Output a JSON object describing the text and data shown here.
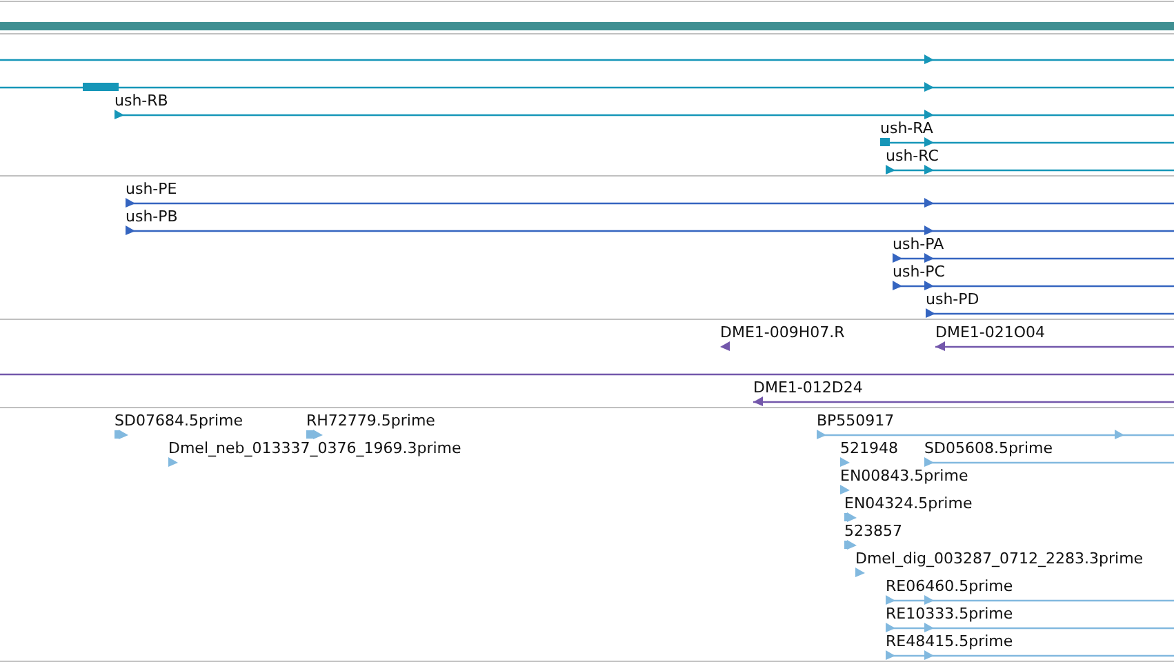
{
  "tracks": [
    {
      "kind": "sequence",
      "color": "#3f8f92"
    },
    {
      "kind": "transcript",
      "color": "#1696b8",
      "rows": [
        {
          "features": [
            {
              "reverse": false
            }
          ]
        },
        {
          "features": [
            {
              "reverse": false
            }
          ]
        },
        {
          "features": [
            {
              "label": "ush-RB",
              "reverse": false
            }
          ]
        },
        {
          "features": [
            {
              "label": "ush-RA",
              "reverse": false
            }
          ]
        },
        {
          "features": [
            {
              "label": "ush-RC",
              "reverse": false
            }
          ]
        }
      ]
    },
    {
      "kind": "protein",
      "color": "#3565c0",
      "rows": [
        {
          "features": [
            {
              "label": "ush-PE",
              "reverse": false
            }
          ]
        },
        {
          "features": [
            {
              "label": "ush-PB",
              "reverse": false
            }
          ]
        },
        {
          "features": [
            {
              "label": "ush-PA",
              "reverse": false
            }
          ]
        },
        {
          "features": [
            {
              "label": "ush-PC",
              "reverse": false
            }
          ]
        },
        {
          "features": [
            {
              "label": "ush-PD",
              "reverse": false
            }
          ]
        }
      ]
    },
    {
      "kind": "clone",
      "color": "#7357ab",
      "rows": [
        {
          "features": [
            {
              "kind": "arrowed",
              "label": "DME1-009H07.R",
              "reverse": true
            },
            {
              "kind": "arrowed",
              "label": "DME1-021O04",
              "reverse": true
            }
          ]
        },
        {
          "features": [
            {
              "kind": "plain"
            }
          ]
        },
        {
          "features": [
            {
              "kind": "arrowed",
              "label": "DME1-012D24",
              "reverse": true
            }
          ]
        }
      ]
    },
    {
      "kind": "est",
      "color": "#82b9df",
      "rows": [
        {
          "features": [
            {
              "label": "SD07684.5prime",
              "reverse": false
            },
            {
              "label": "RH72779.5prime",
              "reverse": false
            },
            {
              "label": "BP550917",
              "reverse": false
            }
          ]
        },
        {
          "features": [
            {
              "label": "Dmel_neb_013337_0376_1969.3prime",
              "reverse": false
            },
            {
              "label": "521948",
              "reverse": false
            },
            {
              "label": "SD05608.5prime",
              "reverse": false
            }
          ]
        },
        {
          "features": [
            {
              "label": "EN00843.5prime",
              "reverse": false
            }
          ]
        },
        {
          "features": [
            {
              "label": "EN04324.5prime",
              "reverse": false
            }
          ]
        },
        {
          "features": [
            {
              "label": "523857",
              "reverse": false
            }
          ]
        },
        {
          "features": [
            {
              "label": "Dmel_dig_003287_0712_2283.3prime",
              "reverse": false
            }
          ]
        },
        {
          "features": [
            {
              "label": "RE06460.5prime",
              "reverse": false
            }
          ]
        },
        {
          "features": [
            {
              "label": "RE10333.5prime",
              "reverse": false
            }
          ]
        },
        {
          "features": [
            {
              "label": "RE48415.5prime",
              "reverse": false
            }
          ]
        }
      ]
    }
  ]
}
